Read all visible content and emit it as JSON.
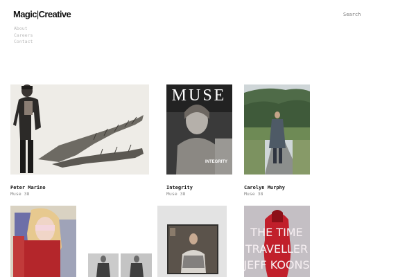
{
  "header": {
    "logo_part1": "Magic",
    "logo_separator": "|",
    "logo_part2": "Creative",
    "search_label": "Search"
  },
  "nav": {
    "items": [
      {
        "label": "About"
      },
      {
        "label": "Careers"
      },
      {
        "label": "Contact"
      }
    ]
  },
  "portfolio": {
    "items": [
      {
        "title": "Peter Marino",
        "subtitle": "Muse 38"
      },
      {
        "title": "Integrity",
        "subtitle": "Muse 38",
        "cover_masthead": "MUSE",
        "cover_text": "INTEGRITY"
      },
      {
        "title": "Carolyn Murphy",
        "subtitle": "Muse 38"
      },
      {
        "title": "",
        "subtitle": ""
      },
      {
        "title": "",
        "subtitle": ""
      },
      {
        "title": "",
        "subtitle": ""
      },
      {
        "title": "",
        "subtitle": "",
        "poster_lines": [
          "THE TIME",
          "TRAVELLER",
          "JEFF KOONS"
        ]
      }
    ]
  }
}
